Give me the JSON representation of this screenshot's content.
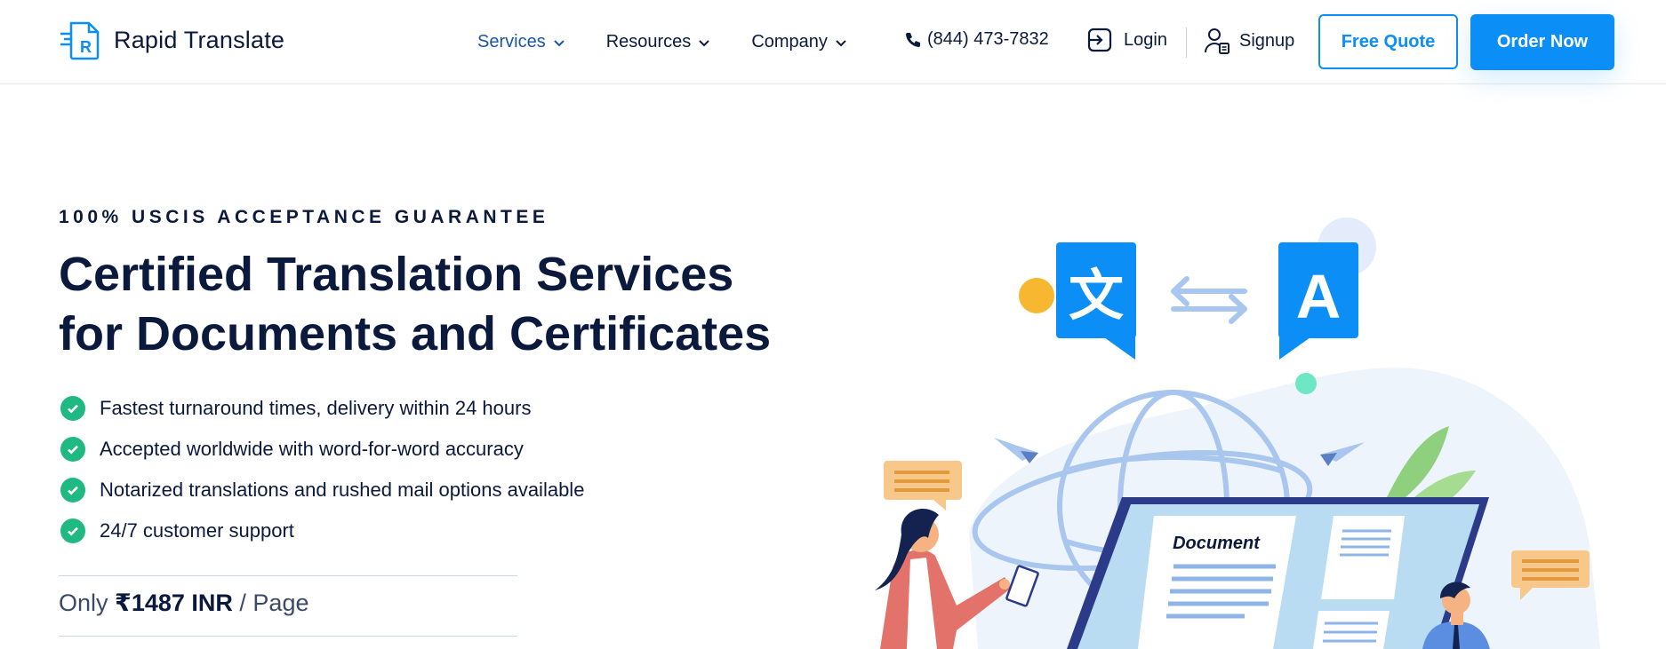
{
  "header": {
    "brand": "Rapid Translate",
    "nav": [
      {
        "label": "Services",
        "active": true
      },
      {
        "label": "Resources",
        "active": false
      },
      {
        "label": "Company",
        "active": false
      }
    ],
    "phone": "(844) 473-7832",
    "login_label": "Login",
    "signup_label": "Signup",
    "quote_label": "Free Quote",
    "order_label": "Order Now"
  },
  "hero": {
    "eyebrow": "100% USCIS ACCEPTANCE GUARANTEE",
    "headline_highlight": "Certified",
    "headline_rest_1": " Translation Services",
    "headline_line2": "for Documents and Certificates",
    "features": [
      "Fastest turnaround times, delivery within 24 hours",
      "Accepted worldwide with word-for-word accuracy",
      "Notarized translations and rushed mail options available",
      "24/7 customer support"
    ],
    "price_prefix": "Only",
    "price_value": "₹1487 INR",
    "price_suffix": "/ Page"
  },
  "illustration": {
    "source_glyph": "文",
    "target_glyph": "A",
    "document_label": "Document"
  },
  "colors": {
    "primary": "#0b8ef6",
    "navy": "#0b1a3c",
    "active_nav": "#1a56a8",
    "check_green": "#1fb981",
    "highlight": "#6ee7c4"
  }
}
